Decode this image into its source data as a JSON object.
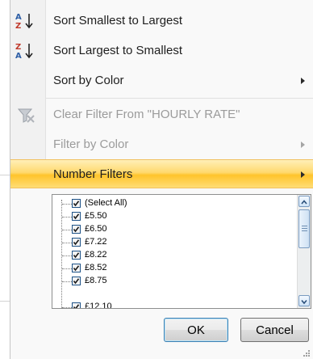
{
  "menu": {
    "items": [
      {
        "label": "Sort Smallest to Largest",
        "icon": "sort-ascending-icon",
        "enabled": true
      },
      {
        "label": "Sort Largest to Smallest",
        "icon": "sort-descending-icon",
        "enabled": true
      },
      {
        "label": "Sort by Color",
        "enabled": true,
        "submenu": true
      },
      {
        "label": "Clear Filter From \"HOURLY RATE\"",
        "icon": "clear-filter-icon",
        "enabled": false
      },
      {
        "label": "Filter by Color",
        "enabled": false,
        "submenu": true
      },
      {
        "label": "Number Filters",
        "enabled": true,
        "submenu": true,
        "highlighted": true
      }
    ]
  },
  "filter_list": {
    "items": [
      {
        "label": "(Select All)",
        "checked": true
      },
      {
        "label": "£5.50",
        "checked": true
      },
      {
        "label": "£6.50",
        "checked": true
      },
      {
        "label": "£7.22",
        "checked": true
      },
      {
        "label": "£8.22",
        "checked": true
      },
      {
        "label": "£8.52",
        "checked": true
      },
      {
        "label": "£8.75",
        "checked": true
      },
      {
        "label": "£12.10",
        "checked": true
      }
    ]
  },
  "buttons": {
    "ok": "OK",
    "cancel": "Cancel"
  },
  "colors": {
    "highlight": "#ffd96e",
    "checkbox_border": "#1d5287",
    "scroll_accent": "#7a9bc0"
  }
}
